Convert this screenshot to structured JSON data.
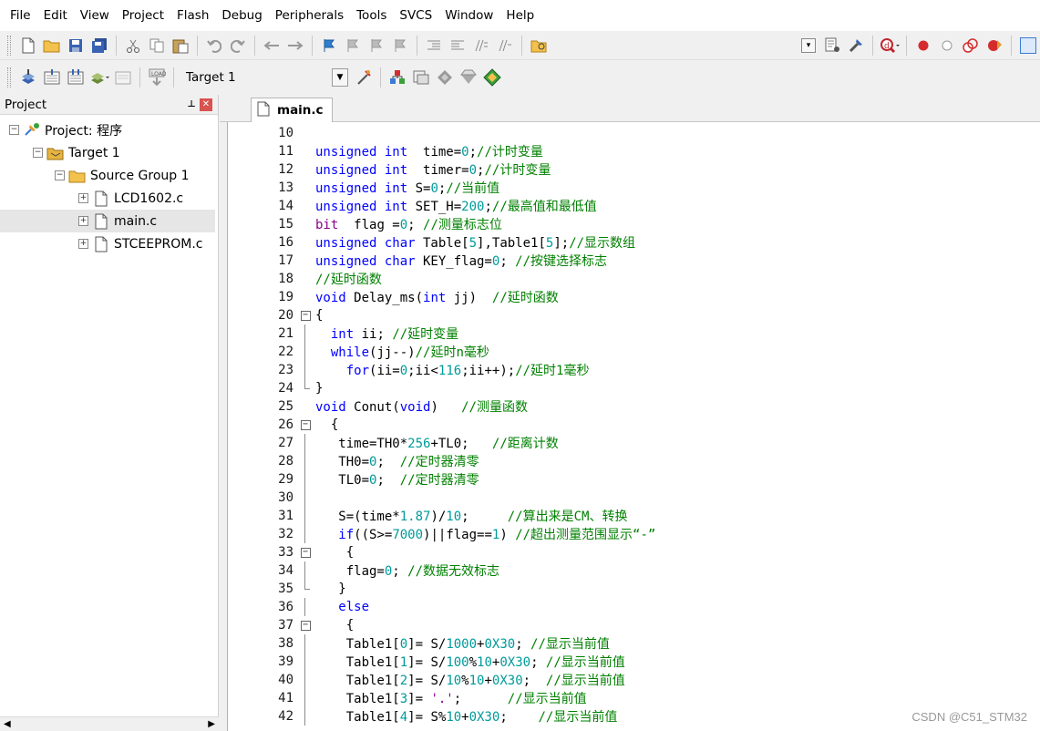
{
  "menu": [
    "File",
    "Edit",
    "View",
    "Project",
    "Flash",
    "Debug",
    "Peripherals",
    "Tools",
    "SVCS",
    "Window",
    "Help"
  ],
  "toolbar": {
    "target_name": "Target 1",
    "icons": [
      "new-file-icon",
      "open-folder-icon",
      "save-icon",
      "save-all-icon",
      "cut-icon",
      "copy-icon",
      "paste-icon",
      "undo-icon",
      "redo-icon",
      "nav-back-icon",
      "nav-forward-icon",
      "bookmark-icon",
      "prev-bookmark-icon",
      "next-bookmark-icon",
      "clear-bookmarks-icon",
      "indent-icon",
      "unindent-icon",
      "comment-icon",
      "uncomment-icon",
      "find-in-files-icon",
      "debug-start-icon",
      "breakpoint-icon",
      "disable-breakpoint-icon",
      "kill-breakpoints-icon",
      "window-layout-icon"
    ],
    "build_icons": [
      "translate-icon",
      "build-icon",
      "rebuild-icon",
      "batch-build-icon",
      "stop-build-icon",
      "download-icon",
      "target-options-icon",
      "manage-project-icon",
      "pack-installer-icon",
      "select-packs-icon"
    ]
  },
  "project_pane": {
    "title": "Project",
    "tree": [
      {
        "label": "Project: 程序",
        "level": 0,
        "icon": "project-icon",
        "expander": "minus"
      },
      {
        "label": "Target 1",
        "level": 1,
        "icon": "target-icon",
        "expander": "minus"
      },
      {
        "label": "Source Group 1",
        "level": 2,
        "icon": "folder-icon",
        "expander": "minus"
      },
      {
        "label": "LCD1602.c",
        "level": 3,
        "icon": "file-icon",
        "expander": "plus"
      },
      {
        "label": "main.c",
        "level": 3,
        "icon": "file-icon",
        "expander": "plus",
        "selected": true
      },
      {
        "label": "STCEEPROM.c",
        "level": 3,
        "icon": "file-icon",
        "expander": "plus"
      }
    ]
  },
  "editor": {
    "active_tab": "main.c",
    "lines": [
      {
        "n": "10",
        "fold": "none",
        "html": ""
      },
      {
        "n": "11",
        "fold": "none",
        "html": "<span class='kw'>unsigned int</span>  time=<span class='num'>0</span>;<span class='cm'>//计时变量</span>"
      },
      {
        "n": "12",
        "fold": "none",
        "html": "<span class='kw'>unsigned int</span>  timer=<span class='num'>0</span>;<span class='cm'>//计时变量</span>"
      },
      {
        "n": "13",
        "fold": "none",
        "html": "<span class='kw'>unsigned int</span> S=<span class='num'>0</span>;<span class='cm'>//当前值</span>"
      },
      {
        "n": "14",
        "fold": "none",
        "html": "<span class='kw'>unsigned int</span> SET_H=<span class='num'>200</span>;<span class='cm'>//最高值和最低值</span>"
      },
      {
        "n": "15",
        "fold": "none",
        "html": "<span class='kw2'>bit</span>  flag =<span class='num'>0</span>; <span class='cm'>//测量标志位</span>"
      },
      {
        "n": "16",
        "fold": "none",
        "html": "<span class='kw'>unsigned char</span> Table[<span class='num'>5</span>],Table1[<span class='num'>5</span>];<span class='cm'>//显示数组</span>"
      },
      {
        "n": "17",
        "fold": "none",
        "html": "<span class='kw'>unsigned char</span> KEY_flag=<span class='num'>0</span>; <span class='cm'>//按键选择标志</span>"
      },
      {
        "n": "18",
        "fold": "none",
        "html": "<span class='cm'>//延时函数</span>"
      },
      {
        "n": "19",
        "fold": "none",
        "html": "<span class='kw'>void</span> Delay_ms(<span class='kw'>int</span> jj)  <span class='cm'>//延时函数</span>"
      },
      {
        "n": "20",
        "fold": "open",
        "html": "{"
      },
      {
        "n": "21",
        "fold": "line",
        "html": "  <span class='kw'>int</span> ii; <span class='cm'>//延时变量</span>"
      },
      {
        "n": "22",
        "fold": "line",
        "html": "  <span class='kw'>while</span>(jj--)<span class='cm'>//延时n毫秒</span>"
      },
      {
        "n": "23",
        "fold": "line",
        "html": "    <span class='kw'>for</span>(ii=<span class='num'>0</span>;ii&lt;<span class='num'>116</span>;ii++);<span class='cm'>//延时1毫秒</span>"
      },
      {
        "n": "24",
        "fold": "end",
        "html": "}"
      },
      {
        "n": "25",
        "fold": "none",
        "html": "<span class='kw'>void</span> Conut(<span class='kw'>void</span>)   <span class='cm'>//测量函数</span>"
      },
      {
        "n": "26",
        "fold": "open",
        "html": "  {"
      },
      {
        "n": "27",
        "fold": "line",
        "html": "   time=TH0*<span class='num'>256</span>+TL0;   <span class='cm'>//距离计数</span>"
      },
      {
        "n": "28",
        "fold": "line",
        "html": "   TH0=<span class='num'>0</span>;  <span class='cm'>//定时器清零</span>"
      },
      {
        "n": "29",
        "fold": "line",
        "html": "   TL0=<span class='num'>0</span>;  <span class='cm'>//定时器清零</span>"
      },
      {
        "n": "30",
        "fold": "line",
        "html": ""
      },
      {
        "n": "31",
        "fold": "line",
        "html": "   S=(time*<span class='num'>1.87</span>)/<span class='num'>10</span>;     <span class='cm'>//算出来是CM、转换</span>"
      },
      {
        "n": "32",
        "fold": "line",
        "html": "   <span class='kw'>if</span>((S&gt;=<span class='num'>7000</span>)||flag==<span class='num'>1</span>) <span class='cm'>//超出测量范围显示“-”</span>"
      },
      {
        "n": "33",
        "fold": "open",
        "html": "    {"
      },
      {
        "n": "34",
        "fold": "line",
        "html": "    flag=<span class='num'>0</span>; <span class='cm'>//数据无效标志</span>"
      },
      {
        "n": "35",
        "fold": "end",
        "html": "   }"
      },
      {
        "n": "36",
        "fold": "line",
        "html": "   <span class='kw'>else</span>"
      },
      {
        "n": "37",
        "fold": "open",
        "html": "    {"
      },
      {
        "n": "38",
        "fold": "line",
        "html": "    Table1[<span class='num'>0</span>]= S/<span class='num'>1000</span>+<span class='num'>0X30</span>; <span class='cm'>//显示当前值</span>"
      },
      {
        "n": "39",
        "fold": "line",
        "html": "    Table1[<span class='num'>1</span>]= S/<span class='num'>100</span>%<span class='num'>10</span>+<span class='num'>0X30</span>; <span class='cm'>//显示当前值</span>"
      },
      {
        "n": "40",
        "fold": "line",
        "html": "    Table1[<span class='num'>2</span>]= S/<span class='num'>10</span>%<span class='num'>10</span>+<span class='num'>0X30</span>;  <span class='cm'>//显示当前值</span>"
      },
      {
        "n": "41",
        "fold": "line",
        "html": "    Table1[<span class='num'>3</span>]= <span class='str'>'.'</span>;      <span class='cm'>//显示当前值</span>"
      },
      {
        "n": "42",
        "fold": "line",
        "html": "    Table1[<span class='num'>4</span>]= S%<span class='num'>10</span>+<span class='num'>0X30</span>;    <span class='cm'>//显示当前值</span>"
      }
    ]
  },
  "watermark": "CSDN @C51_STM32"
}
